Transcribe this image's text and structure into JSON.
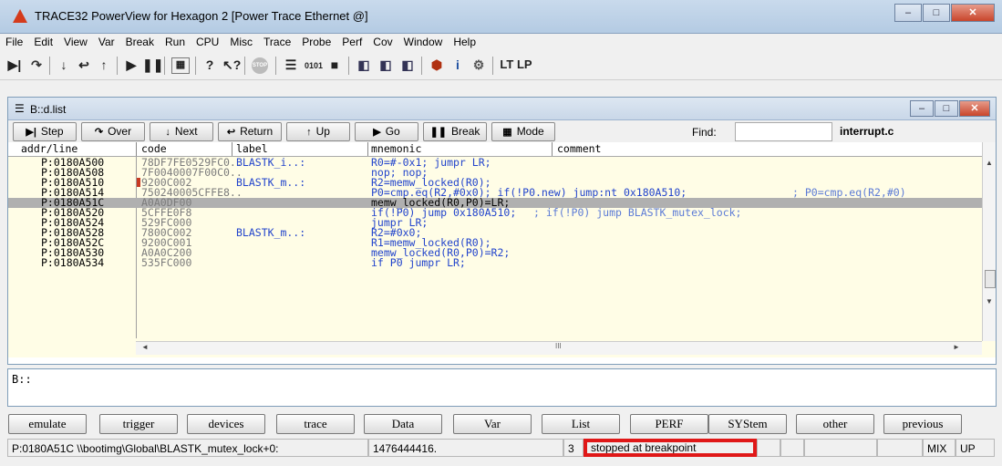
{
  "window": {
    "title": "TRACE32 PowerView for Hexagon 2 [Power Trace Ethernet @]",
    "controls": {
      "minimize": "‒",
      "maximize": "□",
      "close": "✕"
    }
  },
  "menu": [
    "File",
    "Edit",
    "View",
    "Var",
    "Break",
    "Run",
    "CPU",
    "Misc",
    "Trace",
    "Probe",
    "Perf",
    "Cov",
    "Window",
    "Help"
  ],
  "toolbar": {
    "icons": [
      "step-icon",
      "over-icon",
      "next-icon",
      "return-icon",
      "up-icon",
      "go-icon",
      "break-icon",
      "mode-icon",
      "help-icon",
      "context-help-icon",
      "stop-icon",
      "list-icon",
      "memory-icon",
      "register-icon",
      "break-list-icon",
      "symbol-icon",
      "var-icon",
      "ptr-icon",
      "info-icon",
      "settings-icon"
    ],
    "lt_lp": "LT LP"
  },
  "listwin": {
    "title": "B::d.list",
    "buttons": [
      {
        "label": "Step",
        "icon": "▶|"
      },
      {
        "label": "Over",
        "icon": "↷"
      },
      {
        "label": "Next",
        "icon": "↓"
      },
      {
        "label": "Return",
        "icon": "↩"
      },
      {
        "label": "Up",
        "icon": "↑"
      },
      {
        "label": "Go",
        "icon": "▶"
      },
      {
        "label": "Break",
        "icon": "❚❚"
      },
      {
        "label": "Mode",
        "icon": "▦"
      }
    ],
    "find_label": "Find:",
    "find_value": "",
    "source_file": "interrupt.c",
    "columns": [
      "addr/line",
      "code",
      "label",
      "mnemonic",
      "comment"
    ],
    "rows": [
      {
        "addr": "P:0180A500",
        "code": "78DF7FE0529FC0..",
        "label": "BLASTK_i..:",
        "mnem": "R0=#-0x1; jumpr LR;",
        "comment": ""
      },
      {
        "addr": "P:0180A508",
        "code": "7F0040007F00C0..",
        "label": "",
        "mnem": "nop; nop;",
        "comment": ""
      },
      {
        "addr": "P:0180A510",
        "code": "9200C002",
        "label": "BLASTK_m..:",
        "mnem": "R2=memw_locked(R0);",
        "comment": ""
      },
      {
        "addr": "P:0180A514",
        "code": "750240005CFFE8..",
        "label": "",
        "mnem": "P0=cmp.eq(R2,#0x0); if(!P0.new) jump:nt 0x180A510;",
        "comment": "; P0=cmp.eq(R2,#0)"
      },
      {
        "addr": "P:0180A51C",
        "code": "A0A0DF00",
        "label": "",
        "mnem": "memw_locked(R0,P0)=LR;",
        "comment": ""
      },
      {
        "addr": "P:0180A520",
        "code": "5CFFE0F8",
        "label": "",
        "mnem": "if(!P0) jump 0x180A510;",
        "comment": "; if(!P0) jump BLASTK_mutex_lock;"
      },
      {
        "addr": "P:0180A524",
        "code": "529FC000",
        "label": "",
        "mnem": "jumpr LR;",
        "comment": ""
      },
      {
        "addr": "P:0180A528",
        "code": "7800C002",
        "label": "BLASTK_m..:",
        "mnem": "R2=#0x0;",
        "comment": ""
      },
      {
        "addr": "P:0180A52C",
        "code": "9200C001",
        "label": "",
        "mnem": "R1=memw_locked(R0);",
        "comment": ""
      },
      {
        "addr": "P:0180A530",
        "code": "A0A0C200",
        "label": "",
        "mnem": "memw_locked(R0,P0)=R2;",
        "comment": ""
      },
      {
        "addr": "P:0180A534",
        "code": "535FC000",
        "label": "",
        "mnem": "if P0 jumpr LR;",
        "comment": ""
      }
    ],
    "scroll_marks": {
      "up": "▲",
      "down": "▼",
      "left": "◄",
      "right": "►",
      "grip": "III"
    }
  },
  "cmdline": {
    "prompt": "B::"
  },
  "softkeys": [
    "emulate",
    "trigger",
    "devices",
    "trace",
    "Data",
    "Var",
    "List",
    "PERF",
    "SYStem",
    "other",
    "previous"
  ],
  "statusbar": {
    "location": "P:0180A51C  \\\\bootimg\\Global\\BLASTK_mutex_lock+0:",
    "value": "1476444416.",
    "count": "3",
    "state": "stopped at breakpoint",
    "mode": "MIX",
    "dir": "UP"
  },
  "colors": {
    "listing_bg": "#fffde6",
    "selected_row": "#b0b0b0",
    "label_text": "#2244cc",
    "code_text": "#7b7b7b",
    "highlight_box": "#e01818"
  }
}
